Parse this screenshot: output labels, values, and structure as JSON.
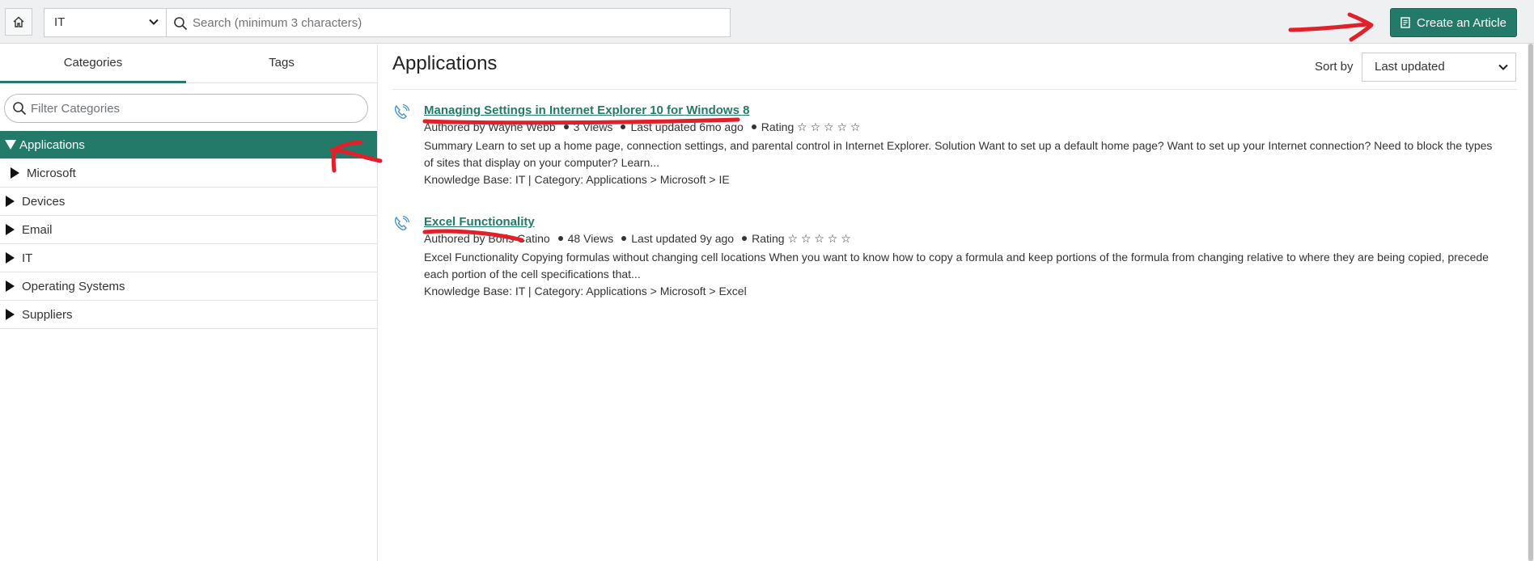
{
  "topbar": {
    "kb_selected": "IT",
    "search_placeholder": "Search (minimum 3 characters)",
    "create_label": "Create an Article"
  },
  "sidebar": {
    "tabs": [
      "Categories",
      "Tags"
    ],
    "filter_placeholder": "Filter Categories",
    "categories": [
      {
        "label": "Applications",
        "state": "expanded",
        "active": true
      },
      {
        "label": "Microsoft",
        "state": "collapsed",
        "sub": true
      },
      {
        "label": "Devices",
        "state": "collapsed"
      },
      {
        "label": "Email",
        "state": "collapsed"
      },
      {
        "label": "IT",
        "state": "collapsed"
      },
      {
        "label": "Operating Systems",
        "state": "collapsed"
      },
      {
        "label": "Suppliers",
        "state": "collapsed"
      }
    ]
  },
  "main": {
    "title": "Applications",
    "sort_label": "Sort by",
    "sort_selected": "Last updated",
    "articles": [
      {
        "title": "Managing Settings in Internet Explorer 10 for Windows 8",
        "author": "Authored by Wayne Webb",
        "views": "3 Views",
        "updated": "Last updated 6mo ago",
        "rating": "Rating ☆ ☆ ☆ ☆ ☆",
        "summary": "Summary Learn to set up a home page, connection settings, and parental control in Internet Explorer. Solution Want to set up a default home page? Want to set up your Internet connection? Need to block the types of sites that display on your computer? Learn...",
        "kb": "Knowledge Base: IT | Category: Applications > Microsoft > IE"
      },
      {
        "title": "Excel Functionality",
        "author": "Authored by Boris Catino",
        "views": "48 Views",
        "updated": "Last updated 9y ago",
        "rating": "Rating ☆ ☆ ☆ ☆ ☆",
        "summary": "Excel Functionality Copying formulas without changing cell locations When you want to know how to copy a formula and keep portions of the formula from changing relative to where they are being copied, precede each portion of the cell specifications that...",
        "kb": "Knowledge Base: IT | Category: Applications > Microsoft > Excel"
      }
    ]
  },
  "colors": {
    "accent": "#237a69",
    "annotation": "#e0202a"
  }
}
